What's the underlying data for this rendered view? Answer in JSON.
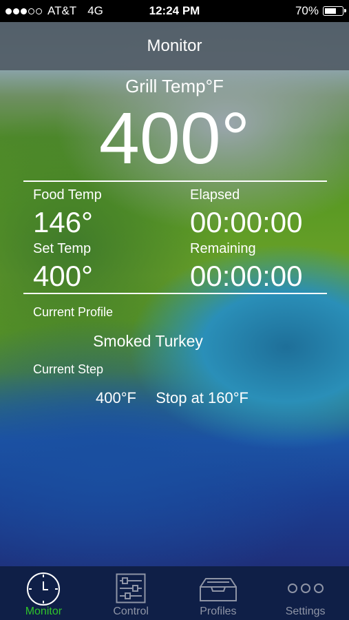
{
  "status_bar": {
    "signal_full": 3,
    "signal_empty": 2,
    "carrier": "AT&T",
    "network": "4G",
    "time": "12:24 PM",
    "battery_text": "70%",
    "battery_level": 0.7
  },
  "nav": {
    "title": "Monitor"
  },
  "grill": {
    "label": "Grill Temp°F",
    "value": "400°"
  },
  "stats": {
    "food_temp_label": "Food Temp",
    "food_temp_value": "146°",
    "elapsed_label": "Elapsed",
    "elapsed_value": "00:00:00",
    "set_temp_label": "Set Temp",
    "set_temp_value": "400°",
    "remaining_label": "Remaining",
    "remaining_value": "00:00:00"
  },
  "profile": {
    "current_profile_label": "Current Profile",
    "current_profile_value": "Smoked Turkey",
    "current_step_label": "Current Step",
    "step_temp": "400°F",
    "step_action": "Stop at 160°F"
  },
  "tabs": [
    {
      "label": "Monitor",
      "icon": "clock-icon",
      "active": true
    },
    {
      "label": "Control",
      "icon": "sliders-icon",
      "active": false
    },
    {
      "label": "Profiles",
      "icon": "tray-icon",
      "active": false
    },
    {
      "label": "Settings",
      "icon": "more-dots-icon",
      "active": false
    }
  ],
  "colors": {
    "active_tab": "#2fc52a",
    "inactive_tab": "#8f95a6",
    "tab_bar": "#0f1f47"
  }
}
